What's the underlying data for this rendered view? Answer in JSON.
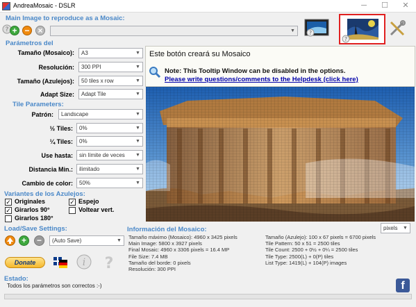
{
  "window": {
    "title": "AndreaMosaic - DSLR",
    "minimize": "─",
    "maximize": "☐",
    "close": "✕"
  },
  "main_image": {
    "heading": "Main Image to reproduce as a Mosaic:",
    "path": ""
  },
  "params": {
    "heading": "Parámetros del",
    "rows": [
      {
        "label": "Tamaño (Mosaico):",
        "value": "A3"
      },
      {
        "label": "Resolución:",
        "value": "300 PPI"
      },
      {
        "label": "Tamaño (Azulejos):",
        "value": "50 tiles x row"
      },
      {
        "label": "Adapt Size:",
        "value": "Adapt Tile"
      }
    ]
  },
  "tile_params": {
    "heading": "Tile Parameters:",
    "rows": [
      {
        "label": "Patrón:",
        "value": "Landscape"
      },
      {
        "label": "½ Tiles:",
        "value": "0%"
      },
      {
        "label": "¼ Tiles:",
        "value": "0%"
      },
      {
        "label": "Use hasta:",
        "value": "sin límite de veces"
      },
      {
        "label": "Distancia Min.:",
        "value": "ilimitado"
      },
      {
        "label": "Cambio de color:",
        "value": "50%"
      }
    ]
  },
  "variants": {
    "heading": "Variantes de los Azulejos:",
    "originales": "Originales",
    "espejo": "Espejo",
    "girarlos90": "Girarlos 90°",
    "voltear": "Voltear vert.",
    "girarlos180": "Girarlos 180°",
    "checkmark": "✓"
  },
  "loadsave": {
    "heading": "Load/Save Settings:",
    "value": "(Auto Save)"
  },
  "donate": {
    "label": "Donate"
  },
  "status": {
    "heading": "Estado:",
    "text": "Todos los parámetros son correctos :-)"
  },
  "tooltip": {
    "title": "Este botón creará su Mosaico",
    "note": "Note: This Tooltip Window can be disabled in the options.",
    "link": "Please write questions/comments to the Helpdesk (click here)"
  },
  "info": {
    "heading": "Información del Mosaico:",
    "units": "pixels",
    "left": [
      "Tamaño máximo (Mosaico): 4960 x 3425 pixels",
      "Main Image: 5800 x 3927 pixels",
      "Final Mosaic: 4960 x 3306 pixels = 16.4 MP",
      "File Size: 7.4 MB",
      "Tamaño del borde: 0 pixels",
      "Resolución: 300 PPI"
    ],
    "right": [
      "Tamaño (Azulejo): 100 x 67 pixels = 6700 pixels",
      "Tile Pattern: 50 x 51 = 2500 tiles",
      "Tile Count: 2500 + 0½ + 0¼ = 2500 tiles",
      "Tile Type: 2500(L) + 0(P) tiles",
      "List Type: 1419(L) + 104(P) images"
    ]
  },
  "icons": {
    "add": "+",
    "remove": "−",
    "clear": "×",
    "help": "?",
    "info": "i",
    "facebook": "f"
  },
  "colors": {
    "accent": "#4a88c8",
    "highlight": "#e02020",
    "link": "#0000aa"
  }
}
